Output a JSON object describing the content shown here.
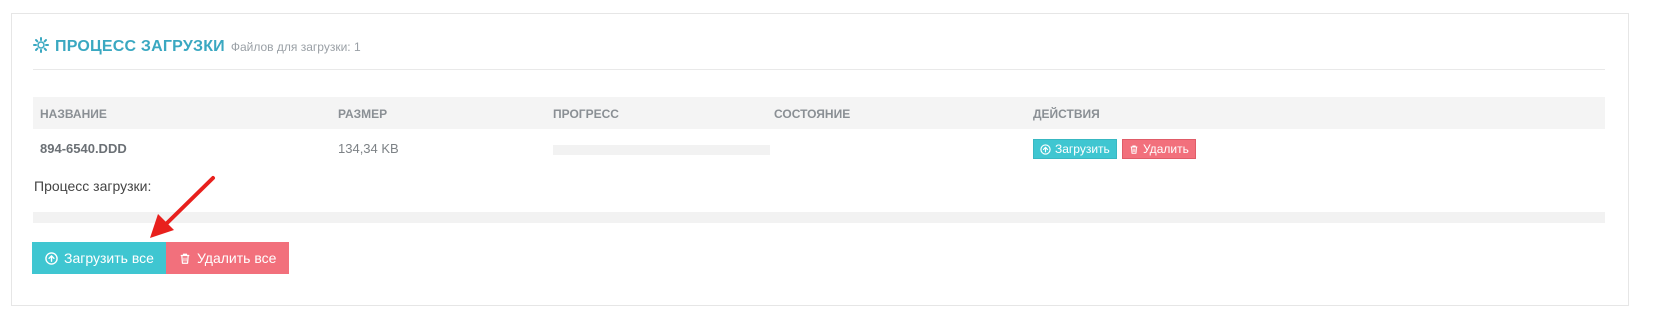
{
  "header": {
    "title": "ПРОЦЕСС ЗАГРУЗКИ",
    "subtitle": "Файлов для загрузки: 1"
  },
  "table": {
    "columns": [
      "НАЗВАНИЕ",
      "РАЗМЕР",
      "ПРОГРЕСС",
      "СОСТОЯНИЕ",
      "ДЕЙСТВИЯ"
    ],
    "rows": [
      {
        "name": "894-6540.DDD",
        "size": "134,34 KB",
        "progress": 0,
        "state": "",
        "upload_label": "Загрузить",
        "delete_label": "Удалить"
      }
    ]
  },
  "process_label": "Процесс загрузки:",
  "total_progress": 0,
  "actions": {
    "upload_all_label": "Загрузить все",
    "delete_all_label": "Удалить все"
  },
  "colors": {
    "accent": "#3aa8c1",
    "info": "#3fc6d1",
    "danger": "#f2707c",
    "annotation_arrow": "#e8201d"
  },
  "icons": [
    "gear-icon",
    "upload-circle-icon",
    "trash-icon",
    "annotation-arrow"
  ]
}
